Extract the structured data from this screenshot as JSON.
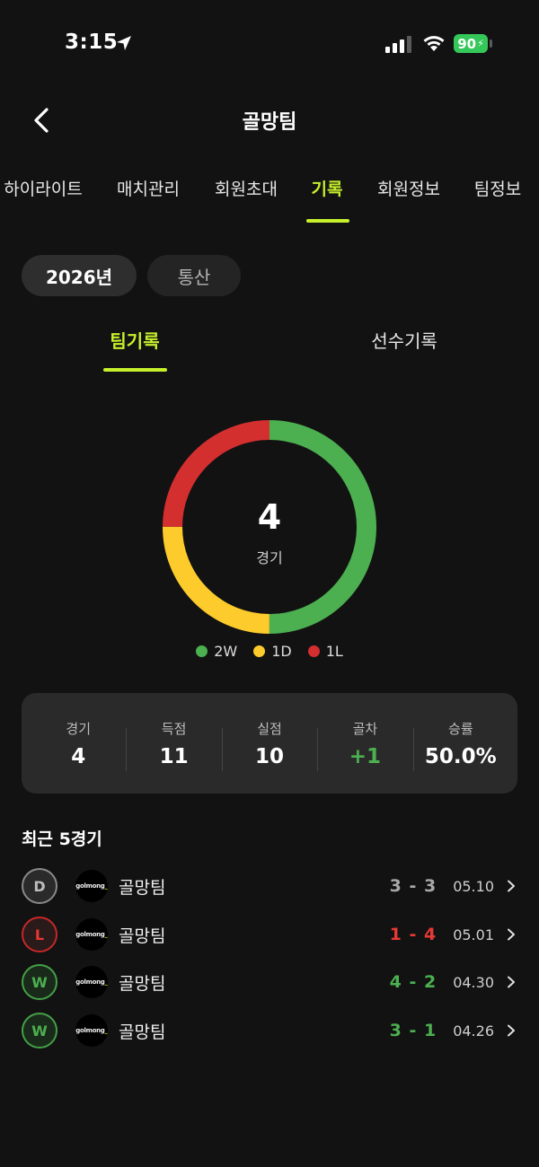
{
  "status_bar": {
    "time": "3:15",
    "battery": "90"
  },
  "header": {
    "title": "골망팀"
  },
  "main_tabs": [
    {
      "label": "하이라이트"
    },
    {
      "label": "매치관리"
    },
    {
      "label": "회원초대"
    },
    {
      "label": "기록",
      "active": true
    },
    {
      "label": "회원정보"
    },
    {
      "label": "팀정보"
    }
  ],
  "period_chips": {
    "year": "2026년",
    "total": "통산"
  },
  "sub_tabs": {
    "team": "팀기록",
    "player": "선수기록"
  },
  "chart_data": {
    "type": "pie",
    "donut": true,
    "center_value": "4",
    "center_label": "경기",
    "slices": [
      {
        "label": "2W",
        "value": 2,
        "color": "#4caf50"
      },
      {
        "label": "1D",
        "value": 1,
        "color": "#fdcb2b"
      },
      {
        "label": "1L",
        "value": 1,
        "color": "#d32f2f"
      }
    ]
  },
  "stats": [
    {
      "label": "경기",
      "value": "4"
    },
    {
      "label": "득점",
      "value": "11"
    },
    {
      "label": "실점",
      "value": "10"
    },
    {
      "label": "골차",
      "value": "+1"
    },
    {
      "label": "승률",
      "value": "50.0%"
    }
  ],
  "recent": {
    "title": "최근 5경기",
    "matches": [
      {
        "result": "D",
        "team": "골망팀",
        "score": "3 - 3",
        "date": "05.10",
        "logo": "golmong"
      },
      {
        "result": "L",
        "team": "골망팀",
        "score": "1 - 4",
        "date": "05.01",
        "logo": "golmong"
      },
      {
        "result": "W",
        "team": "골망팀",
        "score": "4 - 2",
        "date": "04.30",
        "logo": "golmong"
      },
      {
        "result": "W",
        "team": "골망팀",
        "score": "3 - 1",
        "date": "04.26",
        "logo": "golmong"
      }
    ]
  },
  "colors": {
    "accent": "#c6f02c",
    "win": "#4caf50",
    "draw": "#fdcb2b",
    "loss": "#d32f2f"
  }
}
